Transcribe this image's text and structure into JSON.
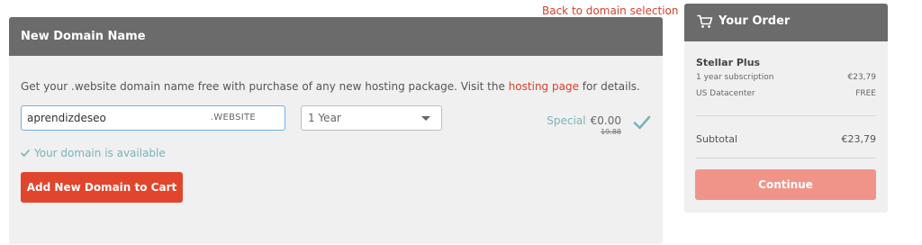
{
  "back_link": "Back to domain selection",
  "panel": {
    "title": "New Domain Name",
    "description_prefix": "Get your .website domain name free with purchase of any new hosting package. Visit the ",
    "description_link": "hosting page",
    "description_suffix": " for details.",
    "domain_value": "aprendizdeseo",
    "tld": ".WEBSITE",
    "period_selected": "1 Year",
    "price_special_label": "Special",
    "price_amount": "€0.00",
    "price_old": "19.88",
    "availability": "Your domain is available",
    "add_button": "Add New Domain to Cart"
  },
  "order": {
    "title": "Your Order",
    "product": "Stellar Plus",
    "items": [
      {
        "label": "1 year subscription",
        "value": "€23,79"
      },
      {
        "label": "US Datacenter",
        "value": "FREE"
      }
    ],
    "subtotal_label": "Subtotal",
    "subtotal_value": "€23,79",
    "continue_button": "Continue"
  },
  "colors": {
    "accent": "#e2452d",
    "header_bg": "#6b6b6b",
    "success": "#7ab3b8",
    "continue_bg": "#f0948a"
  },
  "icons": {
    "cart": "cart-icon",
    "check": "check-icon"
  }
}
